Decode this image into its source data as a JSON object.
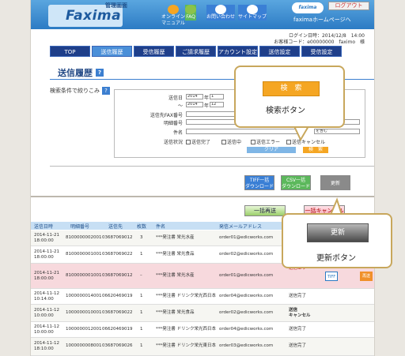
{
  "header": {
    "logo_small": "管理画面",
    "logo_main": "Faxima",
    "nav": [
      {
        "label": "オンライン\nマニュアル"
      },
      {
        "label": "FAQ"
      },
      {
        "label": "お問い合わせ"
      },
      {
        "label": "サイトマップ"
      }
    ],
    "brand": "faxima",
    "home_link": "faximaホームページへ",
    "logout": "ログアウト"
  },
  "user": {
    "login_time": "ログイン日時：2014/12/8　14:00",
    "customer": "お客様コード：e00000000　faximo　様"
  },
  "tabs": [
    {
      "label": "TOP"
    },
    {
      "label": "送信履歴"
    },
    {
      "label": "受信履歴"
    },
    {
      "label": "ご請求履歴"
    },
    {
      "label": "アカウント設定"
    },
    {
      "label": "送信設定"
    },
    {
      "label": "受信設定"
    }
  ],
  "page": {
    "title": "送信履歴",
    "filter_label": "検索条件で絞りこみ"
  },
  "search_form": {
    "send_date_label": "送信日",
    "tilde": "～",
    "year_from": "2014",
    "month_from": "1",
    "year_to": "2014",
    "month_to": "12",
    "year_unit": "年",
    "fax_label": "送信先FAX番号",
    "detail_label": "明細番号",
    "subject_label": "件名",
    "status_label": "送信状況",
    "contains": "を含む",
    "statuses": [
      "送信完了",
      "送信中",
      "送信エラー",
      "送信キャンセル"
    ],
    "clear_button": "クリア",
    "search_button": "検　索"
  },
  "downloads": {
    "tiff": "TIFF一括\nダウンロード",
    "csv": "CSV一括\nダウンロード",
    "update": "更新"
  },
  "bulk": {
    "resend": "一括再送",
    "cancel": "一括キャンセル"
  },
  "table": {
    "headers": [
      "送信日時",
      "明細番号",
      "送信先",
      "枚数",
      "件名",
      "発信メールアドレス"
    ],
    "rows": [
      {
        "date": "2014-11-21\n18:00:00",
        "detail": "8100000002001",
        "dest": "03687069012",
        "pages": "3",
        "subject": "***発注書 栄光水産",
        "email": "order01@edicworks.com",
        "status": ""
      },
      {
        "date": "2014-11-21\n18:00:00",
        "detail": "8100000001001",
        "dest": "03687069022",
        "pages": "1",
        "subject": "***発注書 栄光食品",
        "email": "order02@edicworks.com",
        "status": ""
      },
      {
        "date": "2014-11-21\n18:00:00",
        "detail": "8100000001001",
        "dest": "03687069012",
        "pages": "–",
        "subject": "***発注書 栄光水産",
        "email": "order01@edicworks.com",
        "status": "送信エラー",
        "tiff": "TIFF",
        "resend": "再送"
      },
      {
        "date": "2014-11-12\n10:14:00",
        "detail": "1000000014001",
        "dest": "06620469019",
        "pages": "1",
        "subject": "***発注書 ドリンク栄光西日本",
        "email": "order04@edicworks.com",
        "status": "送信完了"
      },
      {
        "date": "2014-11-12\n10:00:00",
        "detail": "1000000010001",
        "dest": "03687069022",
        "pages": "1",
        "subject": "***発注書 栄光食品",
        "email": "order02@edicworks.com",
        "status": "送信\nキャンセル"
      },
      {
        "date": "2014-11-12\n10:00:00",
        "detail": "1000000012001",
        "dest": "06620469019",
        "pages": "1",
        "subject": "***発注書 ドリンク栄光西日本",
        "email": "order04@edicworks.com",
        "status": "送信完了"
      },
      {
        "date": "2014-11-12\n18:10:00",
        "detail": "1000000008001",
        "dest": "03687069026",
        "pages": "1",
        "subject": "***発注書 ドリンク栄光東日本",
        "email": "order03@edicworks.com",
        "status": "送信完了"
      }
    ]
  },
  "callouts": {
    "search": {
      "button": "検　索",
      "label": "検索ボタン"
    },
    "update": {
      "button": "更新",
      "label": "更新ボタン"
    }
  }
}
